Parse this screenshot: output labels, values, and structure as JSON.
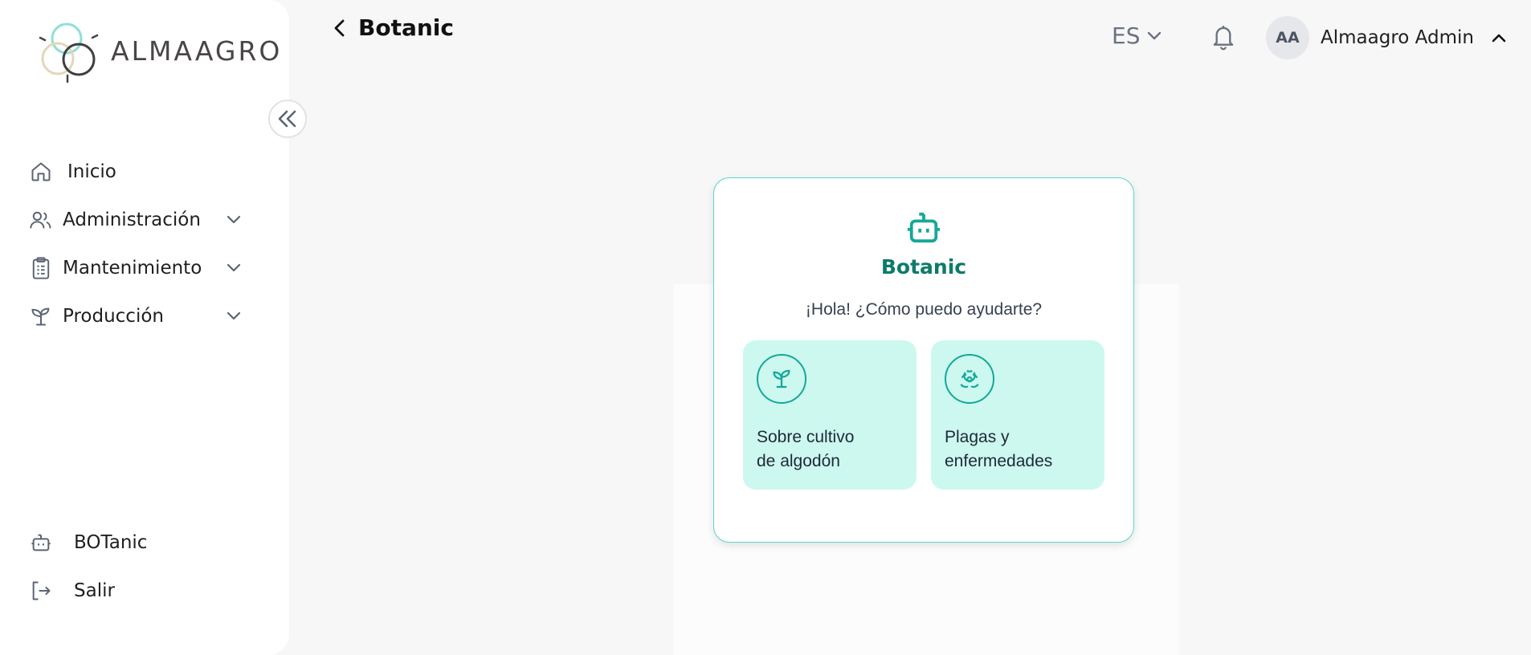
{
  "logo": {
    "text": "ALMAAGRO"
  },
  "sidebar": {
    "items": [
      {
        "label": "Inicio",
        "icon": "home-icon"
      },
      {
        "label": "Administración",
        "icon": "users-icon"
      },
      {
        "label": "Mantenimiento",
        "icon": "clipboard-icon"
      },
      {
        "label": "Producción",
        "icon": "sprout-icon"
      }
    ],
    "bottom_items": [
      {
        "label": "BOTanic",
        "icon": "bot-icon"
      },
      {
        "label": "Salir",
        "icon": "logout-icon"
      }
    ]
  },
  "header": {
    "title": "Botanic",
    "language": "ES",
    "user": {
      "initials": "AA",
      "name": "Almaagro Admin"
    }
  },
  "chat_card": {
    "title": "Botanic",
    "greeting": "¡Hola! ¿Cómo puedo ayudarte?",
    "options": [
      {
        "line1": "Sobre cultivo",
        "line2": "de algodón",
        "icon": "sprout-icon"
      },
      {
        "line1": "Plagas y",
        "line2": "enfermedades",
        "icon": "biohazard-icon"
      }
    ]
  },
  "colors": {
    "accent": "#14a898",
    "accent_dark": "#0d7a6a",
    "option_bg": "#ccf8ef",
    "card_border": "#5dd6c6"
  }
}
